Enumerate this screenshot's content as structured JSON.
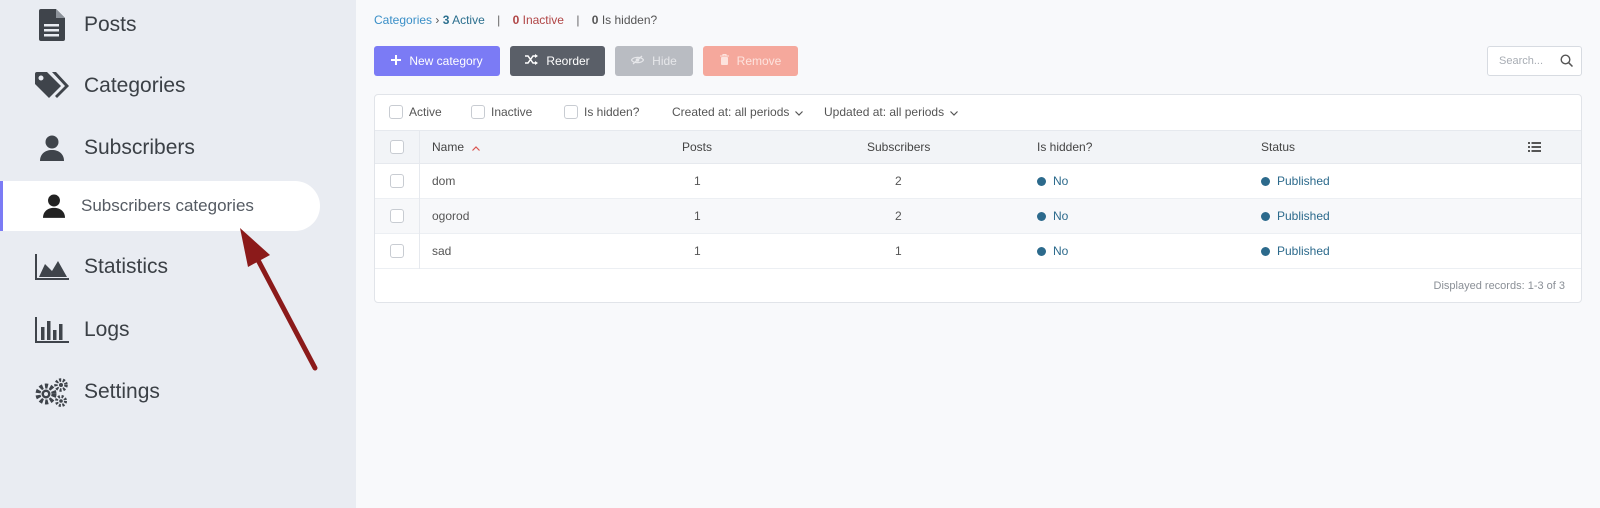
{
  "sidebar": {
    "items": [
      {
        "label": "Posts",
        "icon": "document-icon"
      },
      {
        "label": "Categories",
        "icon": "tags-icon"
      },
      {
        "label": "Subscribers",
        "icon": "user-icon"
      },
      {
        "label": "Subscribers categories",
        "icon": "user-icon",
        "active": true
      },
      {
        "label": "Statistics",
        "icon": "area-chart-icon"
      },
      {
        "label": "Logs",
        "icon": "bar-chart-icon"
      },
      {
        "label": "Settings",
        "icon": "cogs-icon"
      }
    ]
  },
  "breadcrumb": {
    "link": "Categories",
    "arrow": "›",
    "active_count": "3",
    "active_label": "Active",
    "sep": "|",
    "inactive_count": "0",
    "inactive_label": "Inactive",
    "hidden_count": "0",
    "hidden_label": "Is hidden?"
  },
  "toolbar": {
    "new_label": "New category",
    "reorder_label": "Reorder",
    "hide_label": "Hide",
    "remove_label": "Remove",
    "search_placeholder": "Search..."
  },
  "filters": {
    "active": "Active",
    "inactive": "Inactive",
    "hidden": "Is hidden?",
    "created": "Created at: all periods",
    "updated": "Updated at: all periods"
  },
  "table": {
    "columns": [
      "Name",
      "Posts",
      "Subscribers",
      "Is hidden?",
      "Status"
    ],
    "sort_indicator": "^",
    "rows": [
      {
        "name": "dom",
        "posts": "1",
        "subscribers": "2",
        "hidden": "No",
        "status": "Published"
      },
      {
        "name": "ogorod",
        "posts": "1",
        "subscribers": "2",
        "hidden": "No",
        "status": "Published"
      },
      {
        "name": "sad",
        "posts": "1",
        "subscribers": "1",
        "hidden": "No",
        "status": "Published"
      }
    ],
    "footer": "Displayed records: 1-3 of 3"
  },
  "colors": {
    "accent": "#7b7bf5",
    "status_dot": "#2c6a8c",
    "annotation_arrow": "#8b1a1a"
  }
}
